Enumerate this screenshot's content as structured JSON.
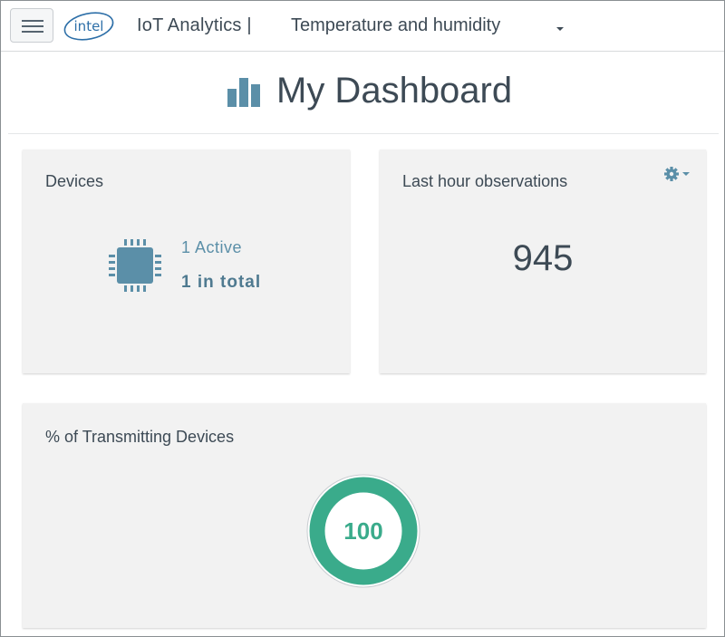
{
  "header": {
    "logo_text": "intel",
    "app_title": "IoT Analytics |",
    "account": "Temperature and humidity"
  },
  "page": {
    "title": "My Dashboard"
  },
  "widgets": {
    "devices": {
      "title": "Devices",
      "active": "1 Active",
      "total": "1 in total"
    },
    "observations": {
      "title": "Last hour observations",
      "value": "945"
    },
    "transmitting": {
      "title": "% of Transmitting Devices",
      "value": "100",
      "percent": 100
    }
  },
  "colors": {
    "accent_teal": "#3aab8b",
    "chip_blue": "#5b8fa8",
    "card_bg": "#f2f2f2"
  }
}
